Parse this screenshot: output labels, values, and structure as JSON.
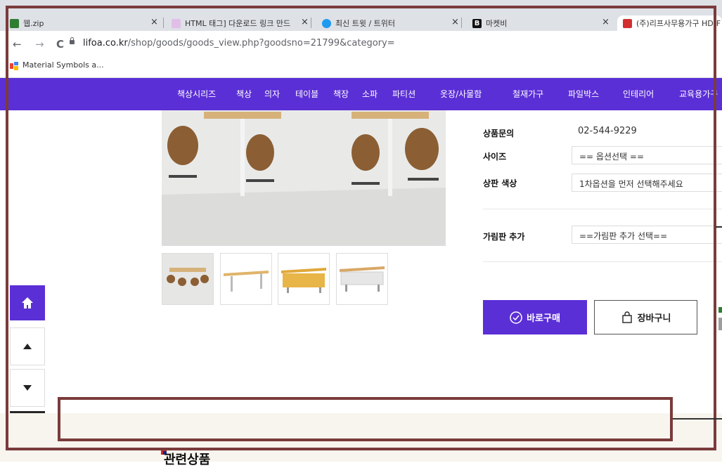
{
  "browser": {
    "tabs": [
      {
        "title": "웹.zip",
        "favicon_color": "#2e7d32"
      },
      {
        "title": "HTML 태그] 다운로드 링크 만드",
        "favicon_color": "#e1bee7"
      },
      {
        "title": "최신 트윗 / 트위터",
        "favicon_color": "#1d9bf0"
      },
      {
        "title": "마켓비",
        "favicon_color": "#111111"
      },
      {
        "title": "(주)리프사무용가구 HD-F",
        "favicon_color": "#d32f2f"
      }
    ],
    "close_glyph": "×",
    "nav": {
      "back": "←",
      "forward": "→",
      "reload": "C"
    },
    "url_host": "lifoa.co.kr",
    "url_path": "/shop/goods/goods_view.php?goodsno=21799&category=",
    "bookmark": {
      "label": "Material Symbols a...",
      "icon": "material-icon"
    }
  },
  "site": {
    "accent_color": "#5b2fd6",
    "menu": [
      "책상시리즈",
      "책상",
      "의자",
      "테이블",
      "책장",
      "소파",
      "파티션",
      "옷장/사물함",
      "철재가구",
      "파일박스",
      "인테리어",
      "교육용가구"
    ]
  },
  "product": {
    "rows": [
      {
        "label": "상품문의",
        "value": "02-544-9229"
      },
      {
        "label": "사이즈",
        "value": "== 옵션선택 =="
      },
      {
        "label": "상판 색상",
        "value": "1차옵션을 먼저 선택해주세요"
      },
      {
        "label": "가림판 추가",
        "value": "==가림판 추가 선택=="
      }
    ],
    "buy_button": "바로구매",
    "cart_button": "장바구니",
    "thumbnails": [
      "thumb-meeting-room",
      "thumb-white-table",
      "thumb-yellow-panel-table",
      "thumb-white-panel-table"
    ]
  },
  "floating": {
    "home_icon": "home-icon",
    "up_icon": "up-arrow-icon",
    "down_icon": "down-arrow-icon",
    "next_icon": "chevron-right-icon"
  },
  "section": {
    "related_title": "관련상품"
  }
}
